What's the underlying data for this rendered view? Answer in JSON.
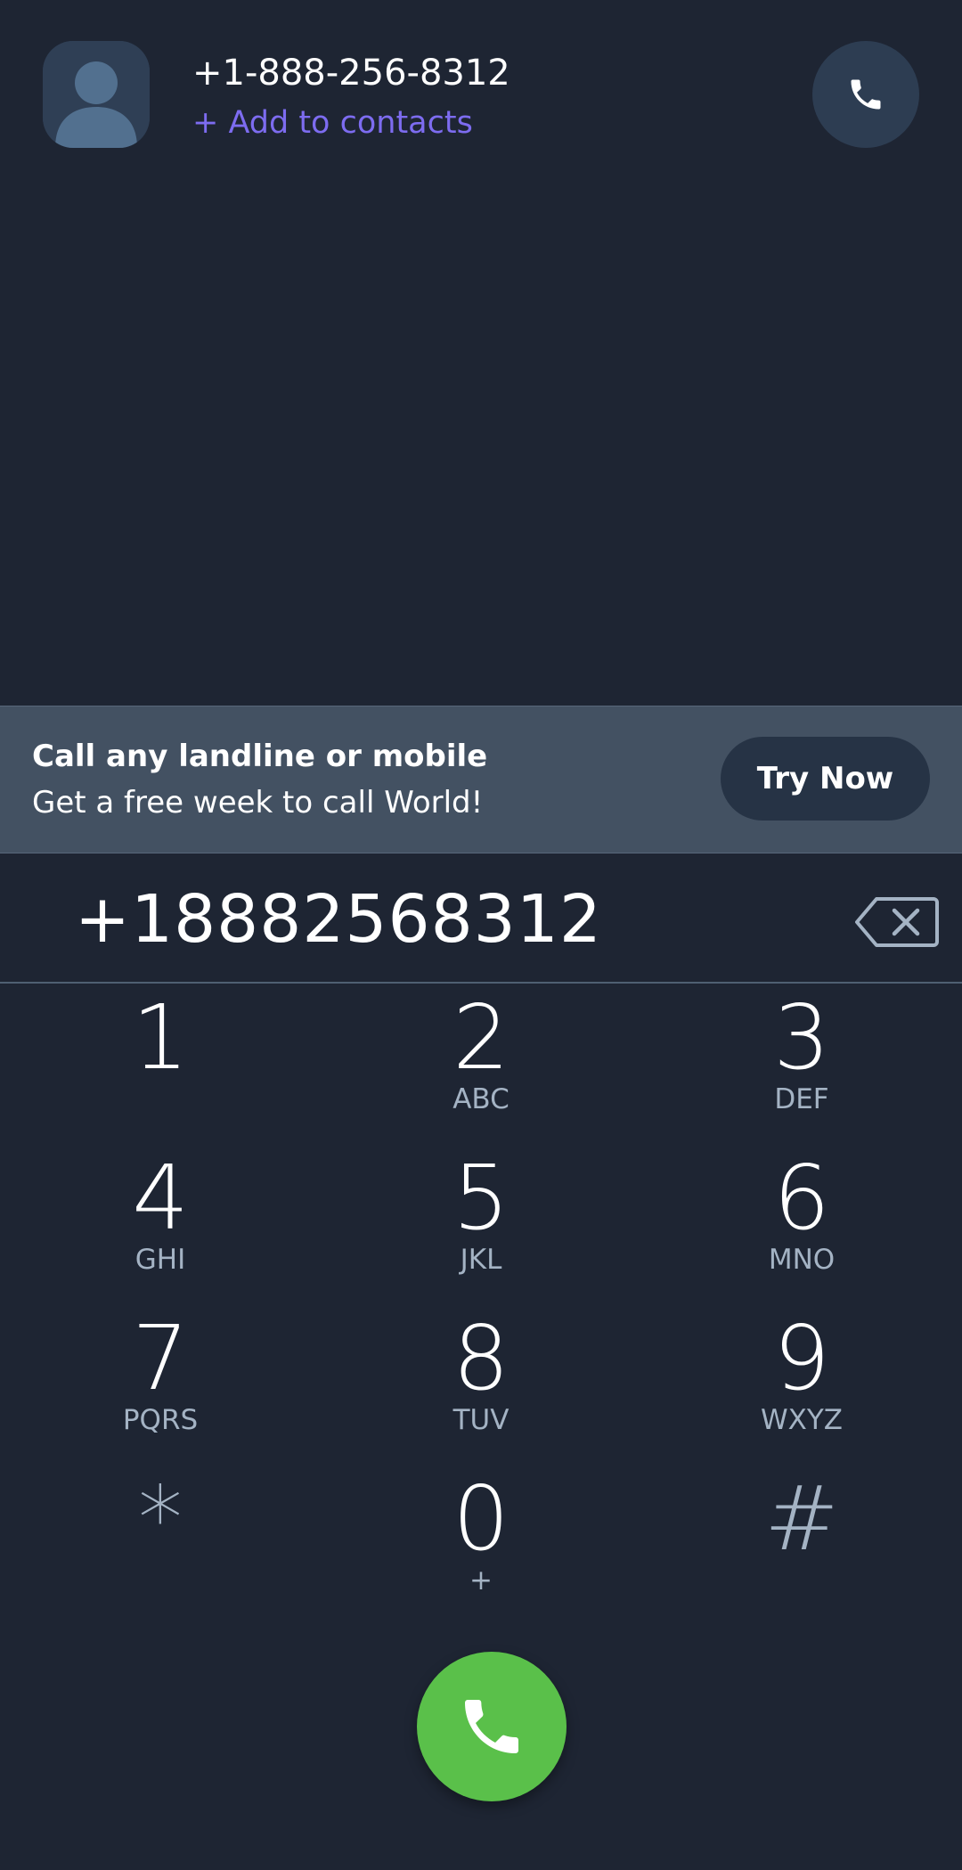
{
  "contact": {
    "number": "+1-888-256-8312",
    "add_label": "+ Add to contacts",
    "avatar_icon": "person-icon",
    "call_icon": "phone-icon"
  },
  "promo": {
    "title": "Call any landline or mobile",
    "subtitle": "Get a free week to call World!",
    "button_label": "Try Now"
  },
  "dialer": {
    "number": "+18882568312",
    "backspace_icon": "backspace-icon"
  },
  "keypad": {
    "keys": [
      {
        "digit": "1",
        "letters": ""
      },
      {
        "digit": "2",
        "letters": "ABC"
      },
      {
        "digit": "3",
        "letters": "DEF"
      },
      {
        "digit": "4",
        "letters": "GHI"
      },
      {
        "digit": "5",
        "letters": "JKL"
      },
      {
        "digit": "6",
        "letters": "MNO"
      },
      {
        "digit": "7",
        "letters": "PQRS"
      },
      {
        "digit": "8",
        "letters": "TUV"
      },
      {
        "digit": "9",
        "letters": "WXYZ"
      },
      {
        "digit": "*",
        "letters": ""
      },
      {
        "digit": "0",
        "letters": "+"
      },
      {
        "digit": "#",
        "letters": ""
      }
    ]
  },
  "call": {
    "icon": "phone-icon"
  },
  "colors": {
    "background": "#1e2533",
    "banner": "#435162",
    "accent_link": "#7d6cf0",
    "call_green": "#5ac04a",
    "secondary_text": "#a4b3c4"
  }
}
